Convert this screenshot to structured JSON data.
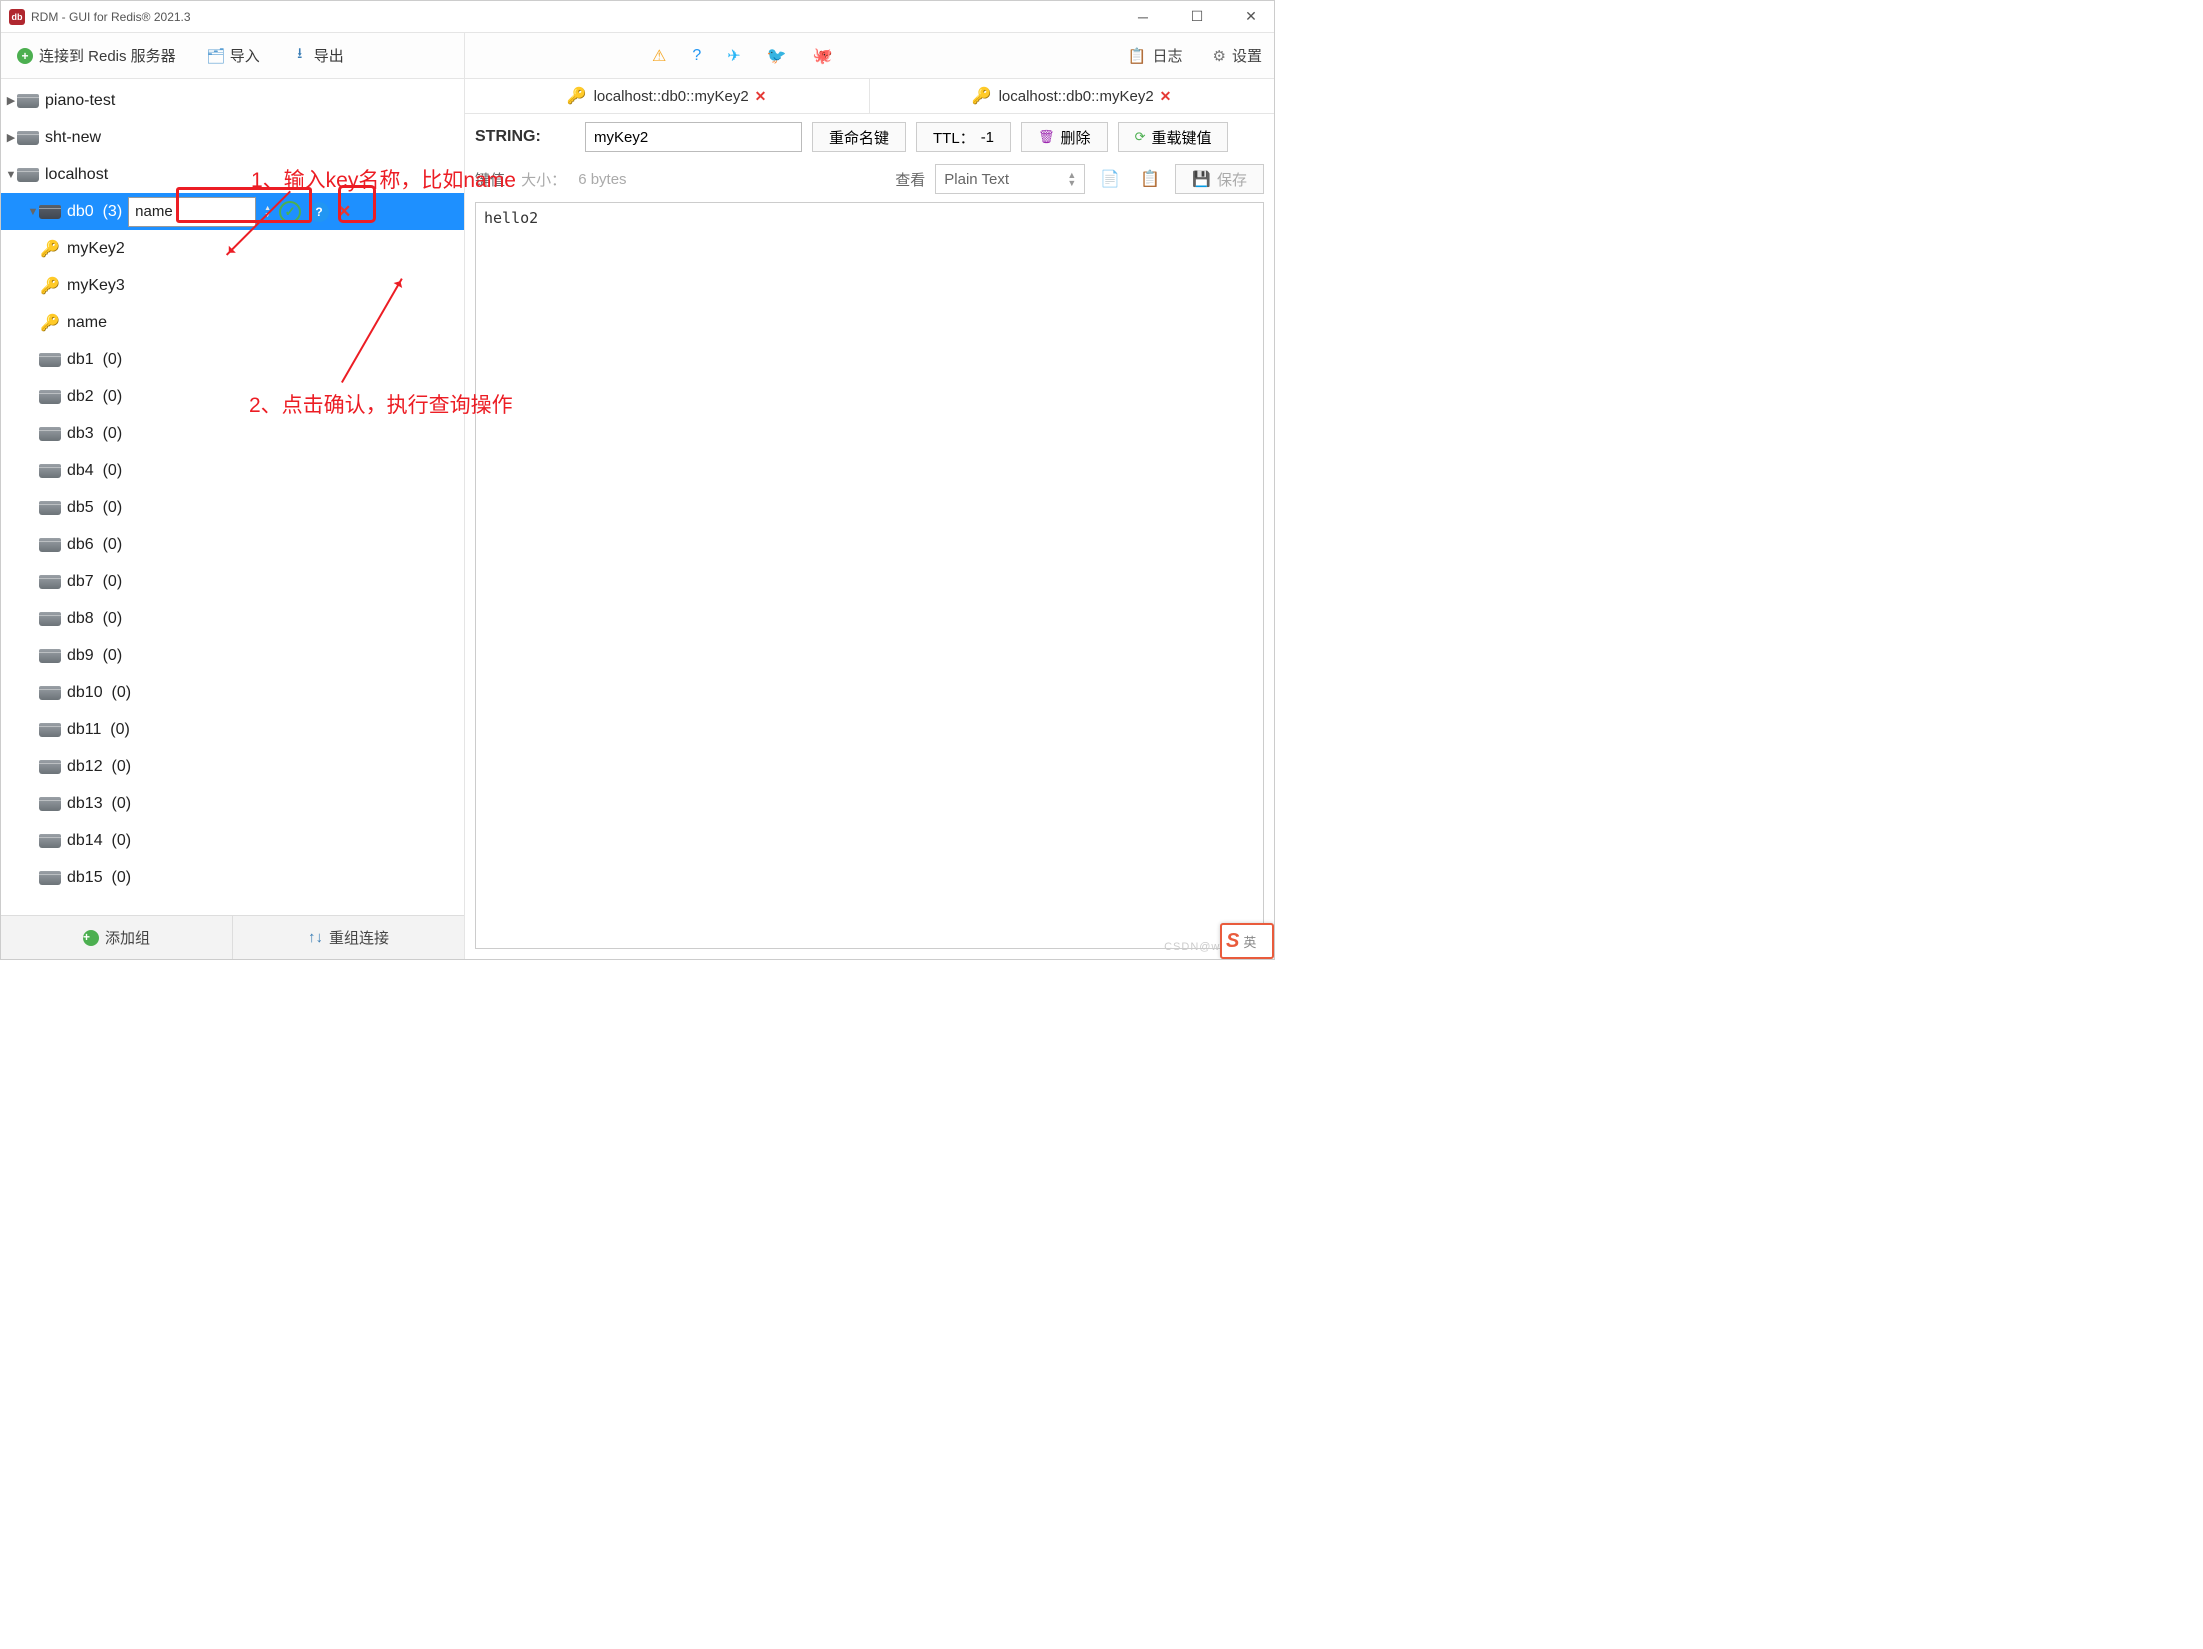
{
  "window": {
    "title": "RDM - GUI for Redis® 2021.3"
  },
  "toolbar": {
    "connect": "连接到 Redis 服务器",
    "import": "导入",
    "export": "导出",
    "log": "日志",
    "settings": "设置"
  },
  "annotations": {
    "step1": "1、输入key名称，比如name",
    "step2": "2、点击确认，执行查询操作"
  },
  "sidebar": {
    "filter_value": "name",
    "connections": [
      {
        "name": "piano-test",
        "expanded": false
      },
      {
        "name": "sht-new",
        "expanded": false
      },
      {
        "name": "localhost",
        "expanded": true,
        "dbs": [
          {
            "name": "db0",
            "count": "(3)",
            "selected": true,
            "keys": [
              "myKey2",
              "myKey3",
              "name"
            ]
          },
          {
            "name": "db1",
            "count": "(0)"
          },
          {
            "name": "db2",
            "count": "(0)"
          },
          {
            "name": "db3",
            "count": "(0)"
          },
          {
            "name": "db4",
            "count": "(0)"
          },
          {
            "name": "db5",
            "count": "(0)"
          },
          {
            "name": "db6",
            "count": "(0)"
          },
          {
            "name": "db7",
            "count": "(0)"
          },
          {
            "name": "db8",
            "count": "(0)"
          },
          {
            "name": "db9",
            "count": "(0)"
          },
          {
            "name": "db10",
            "count": "(0)"
          },
          {
            "name": "db11",
            "count": "(0)"
          },
          {
            "name": "db12",
            "count": "(0)"
          },
          {
            "name": "db13",
            "count": "(0)"
          },
          {
            "name": "db14",
            "count": "(0)"
          },
          {
            "name": "db15",
            "count": "(0)"
          }
        ]
      }
    ],
    "footer": {
      "add_group": "添加组",
      "regroup": "重组连接"
    }
  },
  "tabs": [
    {
      "label": "localhost::db0::myKey2",
      "closable": true
    },
    {
      "label": "localhost::db0::myKey2",
      "closable": true,
      "active": true
    }
  ],
  "keyview": {
    "type_label": "STRING:",
    "key_name": "myKey2",
    "rename": "重命名键",
    "ttl_label": "TTL：",
    "ttl_value": "-1",
    "delete": "删除",
    "reload": "重载键值",
    "value_label": "键值:",
    "size_label": "大小：",
    "size_value": "6 bytes",
    "view_label": "查看",
    "formatter": "Plain Text",
    "save": "保存",
    "value": "hello2"
  },
  "lang_badge": "英"
}
